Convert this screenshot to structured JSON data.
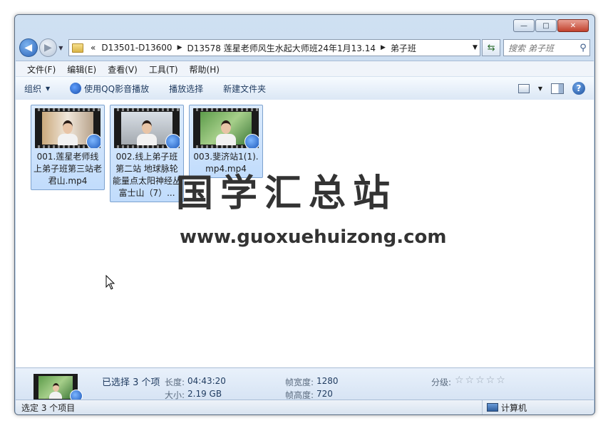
{
  "window": {
    "minimize_glyph": "—",
    "maximize_glyph": "□",
    "close_glyph": "✕"
  },
  "nav": {
    "back_glyph": "◀",
    "forward_glyph": "▶",
    "overflow": "«",
    "breadcrumbs": [
      "D13501-D13600",
      "D13578 莲星老师风生水起大师班24年1月13.14",
      "弟子班"
    ],
    "separator": "▶",
    "refresh_glyph": "⇆",
    "search_placeholder": "搜索 弟子班"
  },
  "menu": [
    "文件(F)",
    "编辑(E)",
    "查看(V)",
    "工具(T)",
    "帮助(H)"
  ],
  "toolbar": {
    "organize": "组织",
    "play_qq": "使用QQ影音播放",
    "play_selection": "播放选择",
    "new_folder": "新建文件夹",
    "help": "?"
  },
  "files": [
    {
      "name": "001.莲星老师线上弟子班第三站老君山.mp4"
    },
    {
      "name": "002.线上弟子班第二站 地球脉轮能量点太阳神经丛 富士山（7）..."
    },
    {
      "name": "003.斐济站1(1).mp4.mp4"
    }
  ],
  "watermark": {
    "cn": "国学汇总站",
    "url": "www.guoxuehuizong.com"
  },
  "details": {
    "selected": "已选择 3 个项",
    "length_label": "长度:",
    "length": "04:43:20",
    "size_label": "大小:",
    "size": "2.19 GB",
    "width_label": "帧宽度:",
    "width": "1280",
    "height_label": "帧高度:",
    "height": "720",
    "rating_label": "分级:",
    "rating_value": 0,
    "rating_stars": "☆☆☆☆☆"
  },
  "status": {
    "left": "选定 3 个项目",
    "right": "计算机"
  }
}
